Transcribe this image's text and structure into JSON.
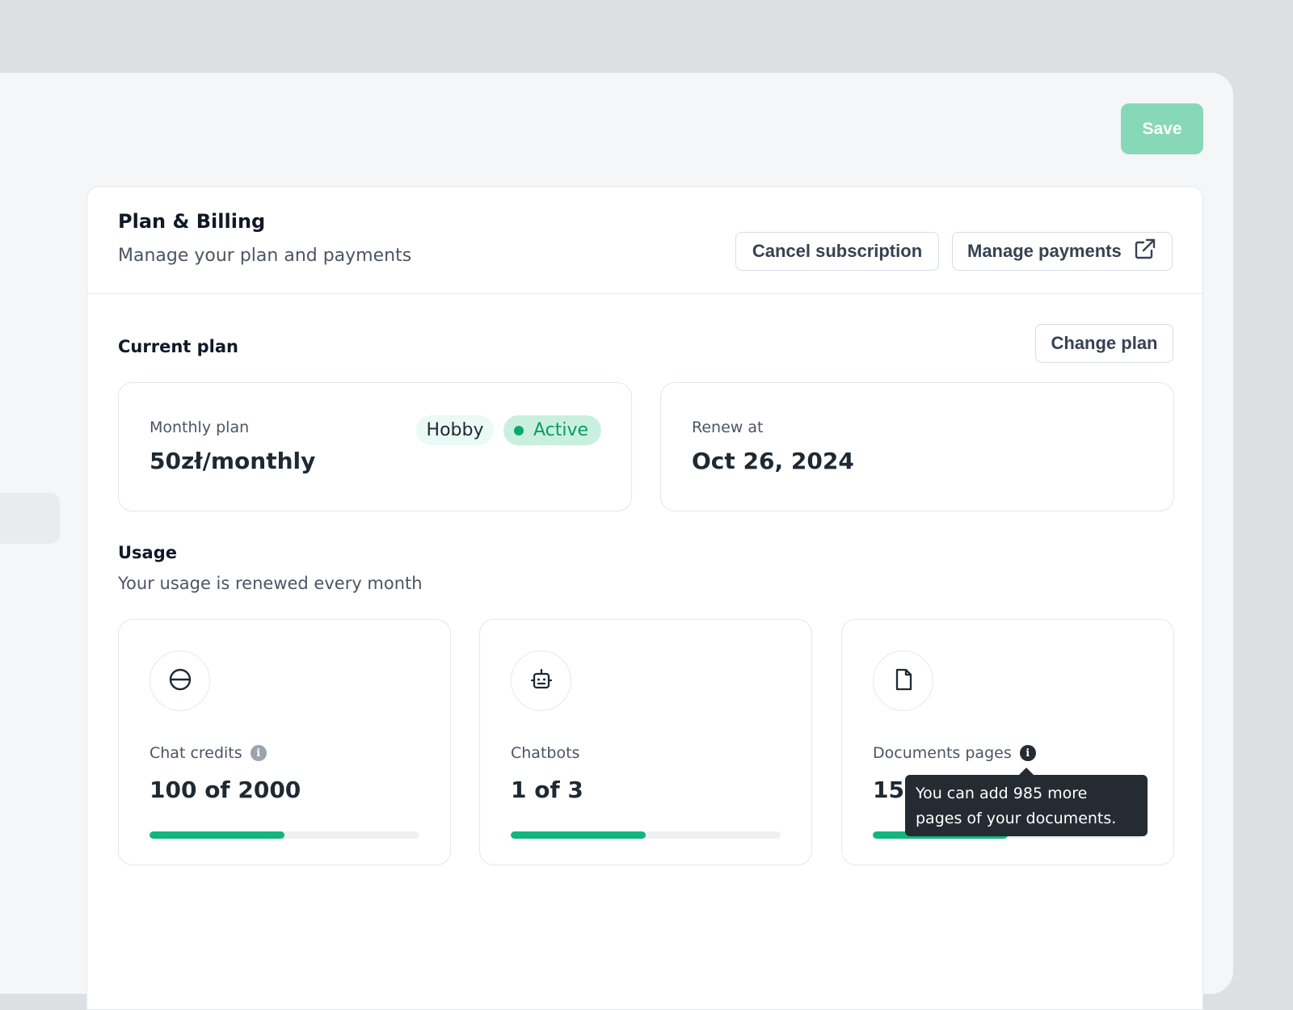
{
  "toolbar": {
    "save_label": "Save"
  },
  "billing": {
    "title": "Plan & Billing",
    "subtitle": "Manage your plan and payments",
    "cancel_label": "Cancel subscription",
    "manage_label": "Manage payments"
  },
  "current_plan": {
    "title": "Current plan",
    "change_label": "Change plan",
    "monthly_label": "Monthly plan",
    "price": "50zł/monthly",
    "plan_badge": "Hobby",
    "status_badge": "Active",
    "renew_label": "Renew at",
    "renew_date": "Oct 26, 2024"
  },
  "usage": {
    "title": "Usage",
    "subtitle": "Your usage is renewed every month",
    "items": [
      {
        "label": "Chat credits",
        "value": "100 of 2000",
        "icon": "chat-credits-icon",
        "progress": 0.5
      },
      {
        "label": "Chatbots",
        "value": "1 of 3",
        "icon": "robot-icon",
        "progress": 0.5
      },
      {
        "label": "Documents pages",
        "value": "15",
        "icon": "document-icon",
        "progress": 0.5
      }
    ],
    "tooltip": "You can add 985 more pages of your documents."
  },
  "colors": {
    "accent": "#12b57b",
    "save_button": "#86d8b8",
    "active_badge": "#c9f0de"
  }
}
